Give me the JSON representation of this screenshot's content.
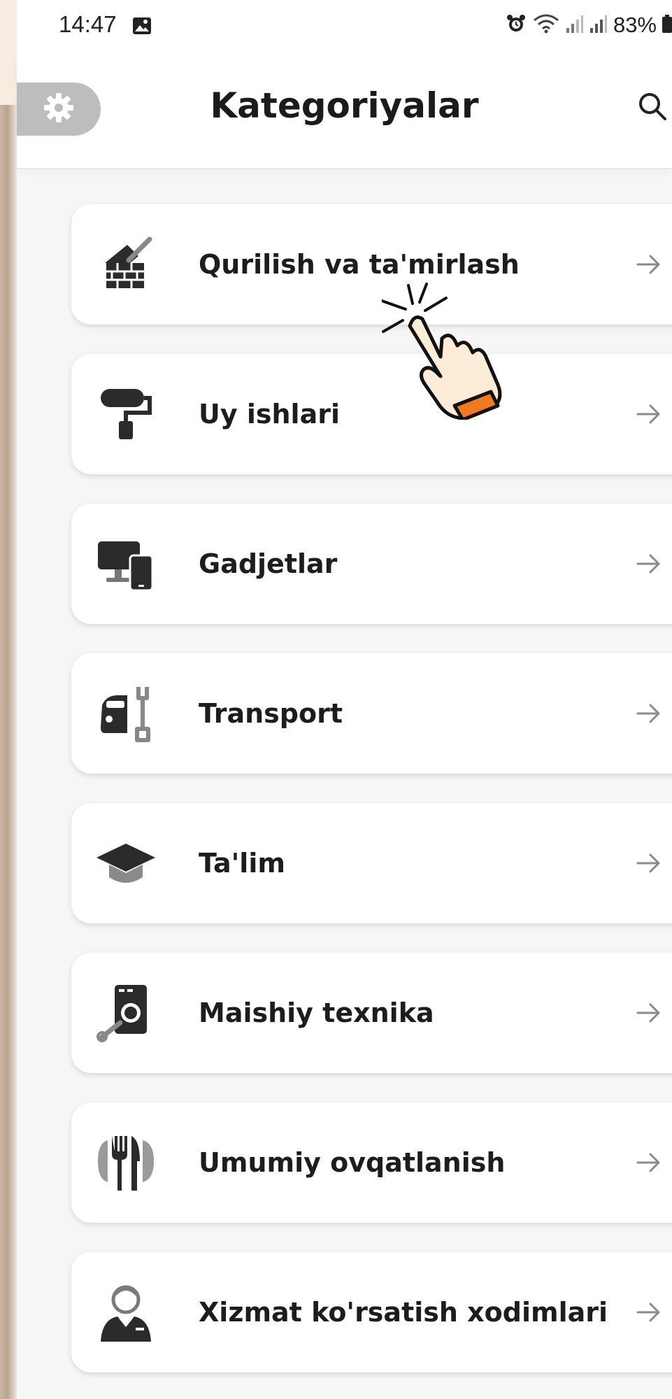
{
  "status_bar": {
    "time": "14:47",
    "battery": "83%"
  },
  "header": {
    "title": "Kategoriyalar",
    "settings_icon": "gear-icon",
    "search_icon": "search-icon"
  },
  "categories": [
    {
      "label": "Qurilish va ta'mirlash",
      "icon": "construction-icon"
    },
    {
      "label": "Uy ishlari",
      "icon": "paint-roller-icon"
    },
    {
      "label": "Gadjetlar",
      "icon": "devices-icon"
    },
    {
      "label": "Transport",
      "icon": "car-repair-icon"
    },
    {
      "label": "Ta'lim",
      "icon": "graduation-cap-icon"
    },
    {
      "label": "Maishiy texnika",
      "icon": "appliance-repair-icon"
    },
    {
      "label": "Umumiy ovqatlanish",
      "icon": "cutlery-icon"
    },
    {
      "label": "Xizmat ko'rsatish xodimlari",
      "icon": "service-staff-icon"
    }
  ],
  "colors": {
    "accent": "#f07b1e",
    "icon": "#2b2b2b",
    "settings_bg": "#bdbdbd"
  }
}
